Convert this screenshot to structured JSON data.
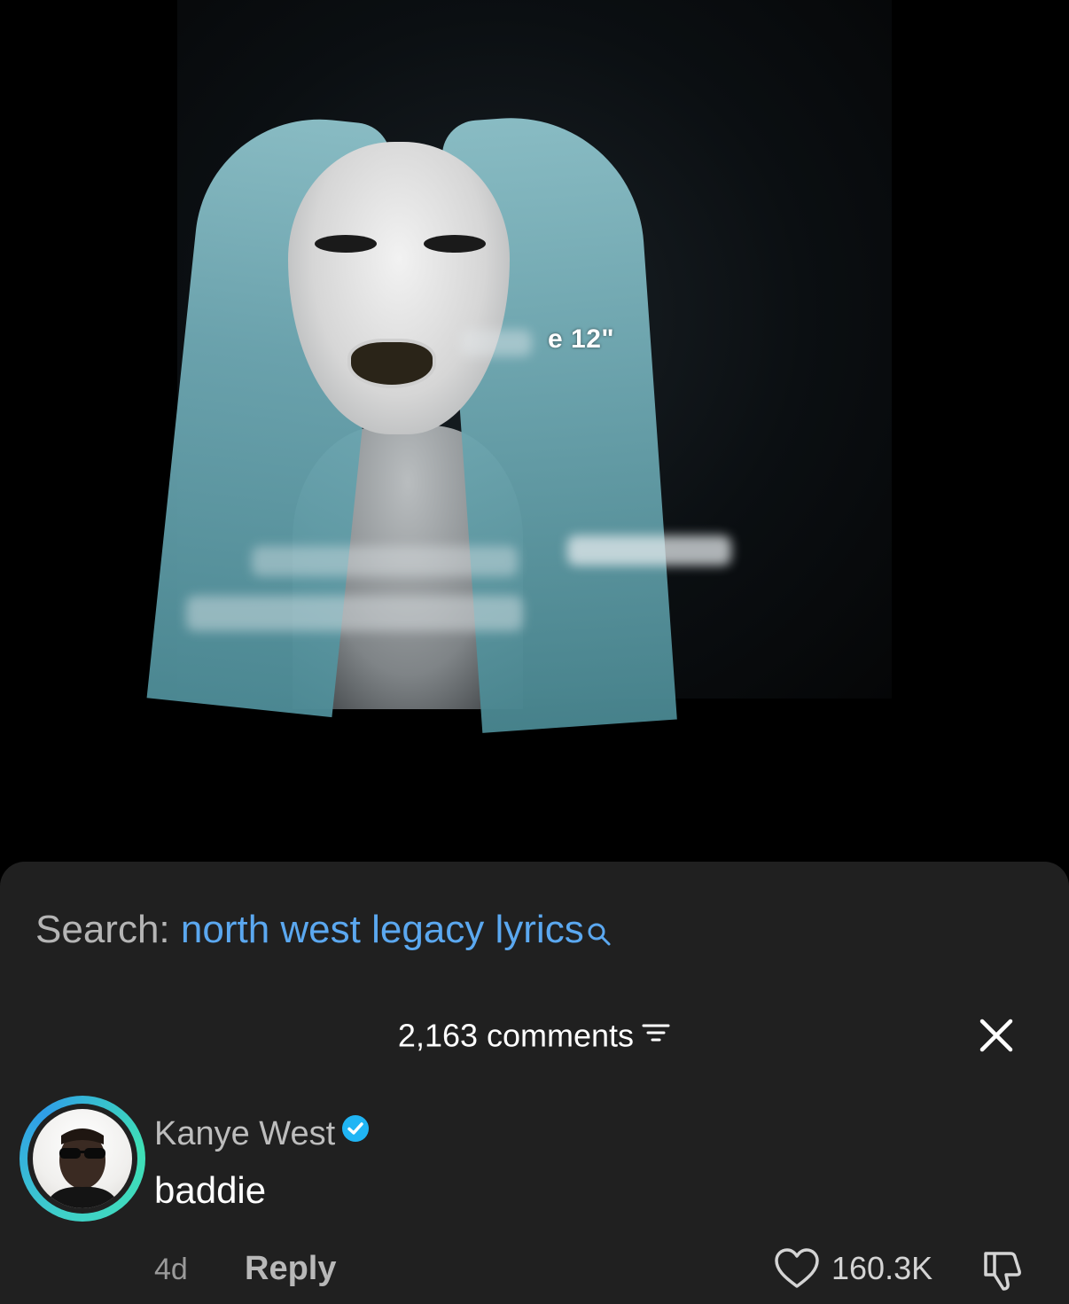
{
  "video": {
    "overlay_text": "e 12\""
  },
  "search": {
    "label": "Search: ",
    "query": "north west legacy lyrics"
  },
  "comments": {
    "count_label": "2,163 comments"
  },
  "comment": {
    "author": "Kanye West",
    "text": "baddie",
    "age": "4d",
    "reply_label": "Reply",
    "likes": "160.3K"
  },
  "colors": {
    "sheet_background": "#202020",
    "search_query": "#5ba8f0",
    "verified_badge": "#20b5f4",
    "avatar_ring": "#3fd0c9"
  }
}
